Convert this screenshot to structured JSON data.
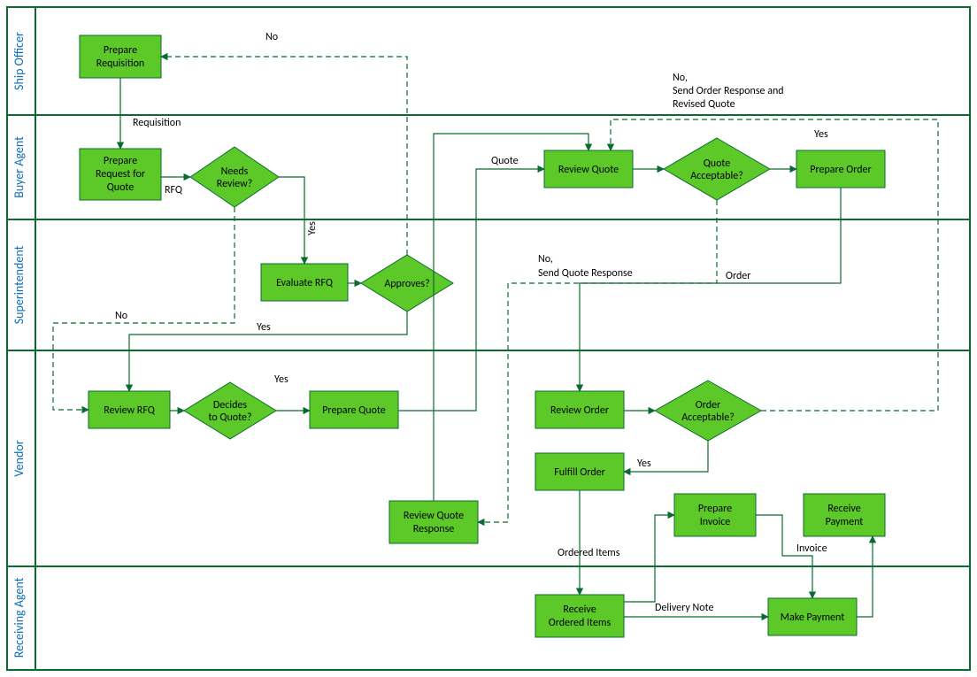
{
  "lanes": {
    "l1": "Ship Officer",
    "l2": "Buyer Agent",
    "l3": "Superintendent",
    "l4": "Vendor",
    "l5": "Receiving Agent"
  },
  "nodes": {
    "prepReq1": "Prepare",
    "prepReq2": "Requisition",
    "prepRFQ1": "Prepare",
    "prepRFQ2": "Request for",
    "prepRFQ3": "Quote",
    "needsRev1": "Needs",
    "needsRev2": "Review?",
    "evalRFQ": "Evaluate RFQ",
    "approves": "Approves?",
    "reviewRFQ": "Review RFQ",
    "decides1": "Decides",
    "decides2": "to Quote?",
    "prepQuote": "Prepare Quote",
    "reviewQuote": "Review Quote",
    "quoteAcc1": "Quote",
    "quoteAcc2": "Acceptable?",
    "prepOrder": "Prepare Order",
    "reviewOrder": "Review Order",
    "orderAcc1": "Order",
    "orderAcc2": "Acceptable?",
    "fulfill": "Fulfill Order",
    "reviewQR1": "Review Quote",
    "reviewQR2": "Response",
    "prepInv1": "Prepare",
    "prepInv2": "Invoice",
    "recvPay1": "Receive",
    "recvPay2": "Payment",
    "recvOrd1": "Receive",
    "recvOrd2": "Ordered Items",
    "makePay": "Make Payment"
  },
  "labels": {
    "no1": "No",
    "requisition": "Requisition",
    "rfq": "RFQ",
    "yesVert": "Yes",
    "yes1": "Yes",
    "no2": "No",
    "quote": "Quote",
    "noSQR1": "No,",
    "noSQR2": "Send Quote Response",
    "yes2": "Yes",
    "noSOR1": "No,",
    "noSOR2": "Send Order Response and",
    "noSOR3": "Revised Quote",
    "yes3": "Yes",
    "order": "Order",
    "yes4": "Yes",
    "orderedItems": "Ordered Items",
    "deliveryNote": "Delivery Note",
    "invoice": "Invoice"
  },
  "chart_data": {
    "type": "swimlane-flowchart",
    "title": "",
    "lanes": [
      "Ship Officer",
      "Buyer Agent",
      "Superintendent",
      "Vendor",
      "Receiving Agent"
    ],
    "nodes": [
      {
        "id": "prepReq",
        "lane": "Ship Officer",
        "type": "process",
        "label": "Prepare Requisition"
      },
      {
        "id": "prepRFQ",
        "lane": "Buyer Agent",
        "type": "process",
        "label": "Prepare Request for Quote"
      },
      {
        "id": "needsRev",
        "lane": "Buyer Agent",
        "type": "decision",
        "label": "Needs Review?"
      },
      {
        "id": "evalRFQ",
        "lane": "Superintendent",
        "type": "process",
        "label": "Evaluate RFQ"
      },
      {
        "id": "approves",
        "lane": "Superintendent",
        "type": "decision",
        "label": "Approves?"
      },
      {
        "id": "reviewRFQ",
        "lane": "Vendor",
        "type": "process",
        "label": "Review RFQ"
      },
      {
        "id": "decides",
        "lane": "Vendor",
        "type": "decision",
        "label": "Decides to Quote?"
      },
      {
        "id": "prepQuote",
        "lane": "Vendor",
        "type": "process",
        "label": "Prepare Quote"
      },
      {
        "id": "reviewQuote",
        "lane": "Buyer Agent",
        "type": "process",
        "label": "Review Quote"
      },
      {
        "id": "quoteAcc",
        "lane": "Buyer Agent",
        "type": "decision",
        "label": "Quote Acceptable?"
      },
      {
        "id": "prepOrder",
        "lane": "Buyer Agent",
        "type": "process",
        "label": "Prepare Order"
      },
      {
        "id": "reviewOrder",
        "lane": "Vendor",
        "type": "process",
        "label": "Review Order"
      },
      {
        "id": "orderAcc",
        "lane": "Vendor",
        "type": "decision",
        "label": "Order Acceptable?"
      },
      {
        "id": "fulfill",
        "lane": "Vendor",
        "type": "process",
        "label": "Fulfill Order"
      },
      {
        "id": "reviewQR",
        "lane": "Vendor",
        "type": "process",
        "label": "Review Quote Response"
      },
      {
        "id": "prepInv",
        "lane": "Vendor",
        "type": "process",
        "label": "Prepare Invoice"
      },
      {
        "id": "recvPay",
        "lane": "Vendor",
        "type": "process",
        "label": "Receive Payment"
      },
      {
        "id": "recvOrd",
        "lane": "Receiving Agent",
        "type": "process",
        "label": "Receive Ordered Items"
      },
      {
        "id": "makePay",
        "lane": "Receiving Agent",
        "type": "process",
        "label": "Make Payment"
      }
    ],
    "edges": [
      {
        "from": "prepReq",
        "to": "prepRFQ",
        "label": "Requisition",
        "style": "solid"
      },
      {
        "from": "prepRFQ",
        "to": "needsRev",
        "label": "RFQ",
        "style": "solid"
      },
      {
        "from": "needsRev",
        "to": "evalRFQ",
        "label": "Yes",
        "style": "solid"
      },
      {
        "from": "evalRFQ",
        "to": "approves",
        "label": "",
        "style": "solid"
      },
      {
        "from": "approves",
        "to": "prepReq",
        "label": "No",
        "style": "dashed"
      },
      {
        "from": "approves",
        "to": "reviewRFQ",
        "label": "Yes",
        "style": "solid"
      },
      {
        "from": "needsRev",
        "to": "reviewRFQ",
        "label": "No",
        "style": "dashed"
      },
      {
        "from": "reviewRFQ",
        "to": "decides",
        "label": "",
        "style": "solid"
      },
      {
        "from": "decides",
        "to": "prepQuote",
        "label": "Yes",
        "style": "solid"
      },
      {
        "from": "prepQuote",
        "to": "reviewQuote",
        "label": "Quote",
        "style": "solid"
      },
      {
        "from": "reviewQuote",
        "to": "quoteAcc",
        "label": "",
        "style": "solid"
      },
      {
        "from": "quoteAcc",
        "to": "prepOrder",
        "label": "Yes",
        "style": "solid"
      },
      {
        "from": "quoteAcc",
        "to": "reviewQR",
        "label": "No, Send Quote Response",
        "style": "dashed"
      },
      {
        "from": "reviewQR",
        "to": "reviewQuote",
        "label": "",
        "style": "solid"
      },
      {
        "from": "prepOrder",
        "to": "reviewOrder",
        "label": "Order",
        "style": "solid"
      },
      {
        "from": "reviewOrder",
        "to": "orderAcc",
        "label": "",
        "style": "solid"
      },
      {
        "from": "orderAcc",
        "to": "reviewQuote",
        "label": "No, Send Order Response and Revised Quote",
        "style": "dashed"
      },
      {
        "from": "orderAcc",
        "to": "fulfill",
        "label": "Yes",
        "style": "solid"
      },
      {
        "from": "fulfill",
        "to": "recvOrd",
        "label": "Ordered Items",
        "style": "solid"
      },
      {
        "from": "recvOrd",
        "to": "prepInv",
        "label": "Delivery Note",
        "style": "solid"
      },
      {
        "from": "prepInv",
        "to": "makePay",
        "label": "Invoice",
        "style": "solid"
      },
      {
        "from": "makePay",
        "to": "recvPay",
        "label": "",
        "style": "solid"
      }
    ]
  }
}
